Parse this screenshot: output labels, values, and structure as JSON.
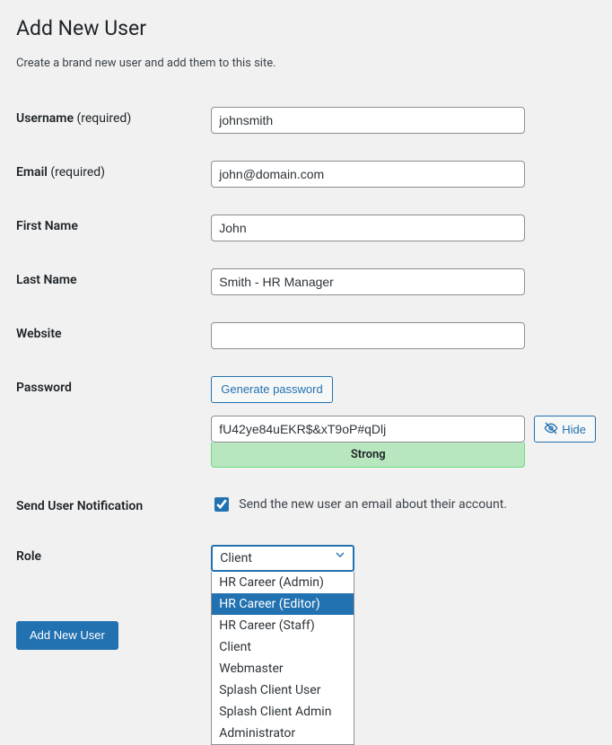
{
  "page_title": "Add New User",
  "intro": "Create a brand new user and add them to this site.",
  "labels": {
    "username": "Username",
    "email": "Email",
    "first_name": "First Name",
    "last_name": "Last Name",
    "website": "Website",
    "password": "Password",
    "send_notification": "Send User Notification",
    "role": "Role",
    "required": " (required)"
  },
  "fields": {
    "username": "johnsmith",
    "email": "john@domain.com",
    "first_name": "John",
    "last_name": "Smith - HR Manager",
    "website": "",
    "password": "fU42ye84uEKR$&xT9oP#qDlj"
  },
  "buttons": {
    "generate_password": "Generate password",
    "hide": "Hide",
    "submit": "Add New User"
  },
  "password_strength": "Strong",
  "notification_text": "Send the new user an email about their account.",
  "notification_checked": true,
  "role": {
    "selected": "Client",
    "options": [
      "HR Career (Admin)",
      "HR Career (Editor)",
      "HR Career (Staff)",
      "Client",
      "Webmaster",
      "Splash Client User",
      "Splash Client Admin",
      "Administrator"
    ],
    "highlighted_index": 1
  }
}
